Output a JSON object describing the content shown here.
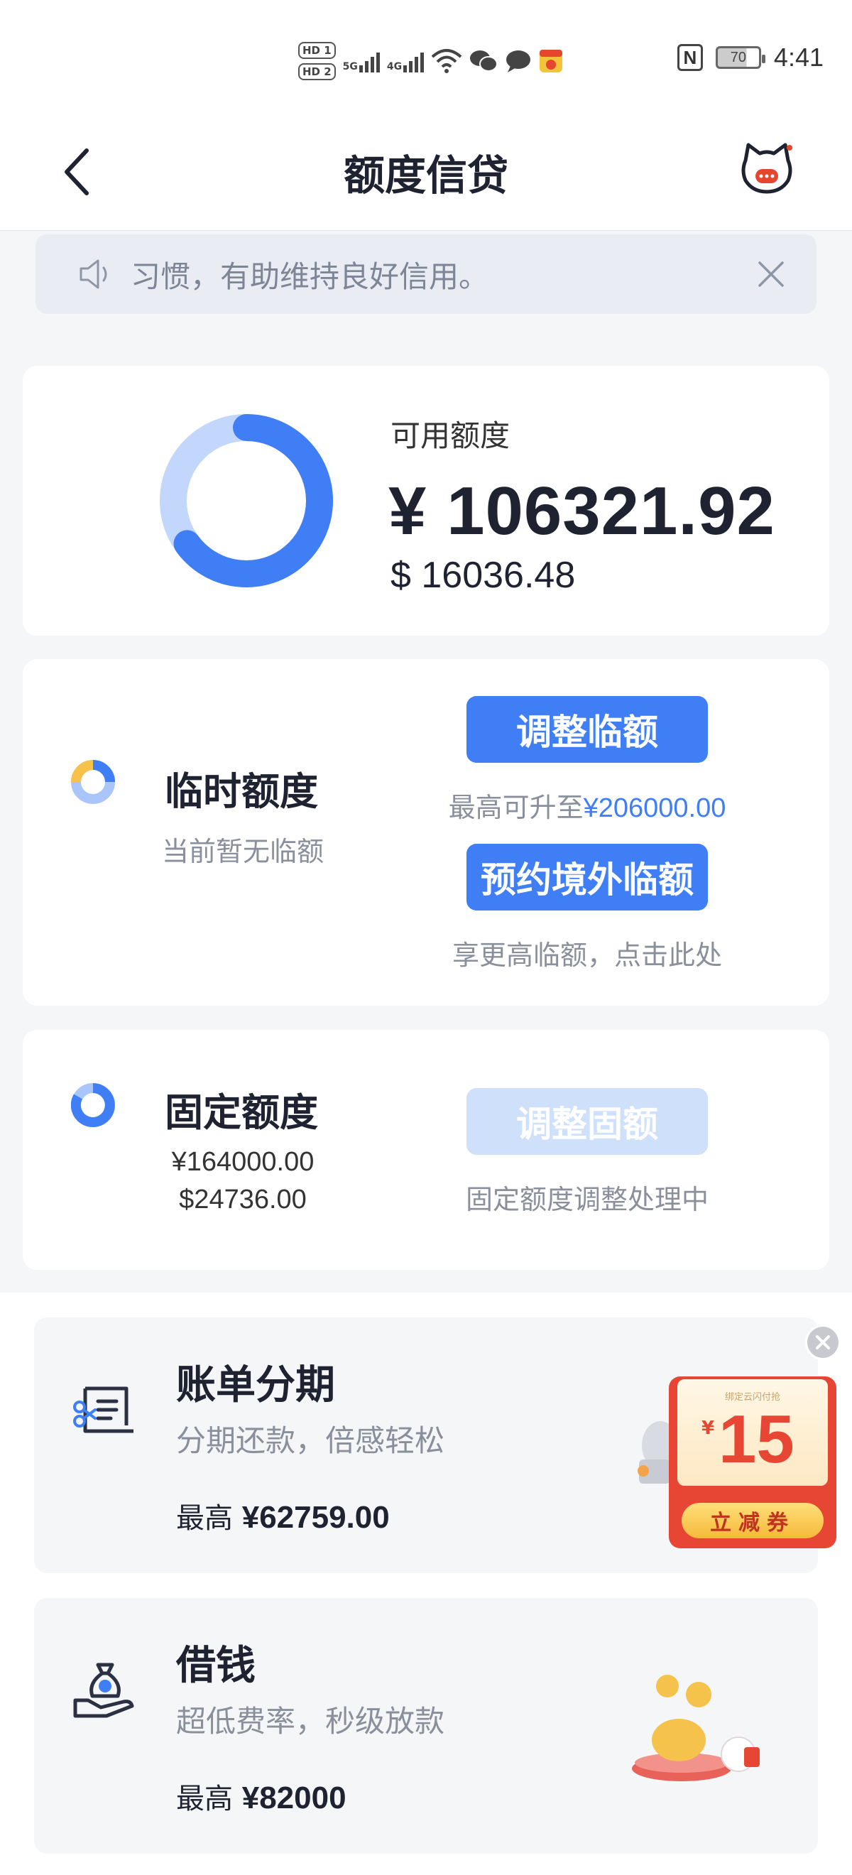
{
  "status_bar": {
    "hd1": "HD 1",
    "hd2": "HD 2",
    "net1": "5G",
    "net2": "4G",
    "battery": "70",
    "time": "4:41"
  },
  "header": {
    "title": "额度信贷"
  },
  "notice": {
    "text": "习惯，有助维持良好信用。"
  },
  "available": {
    "label": "可用额度",
    "cny": "¥ 106321.92",
    "usd": "$ 16036.48",
    "ring_fraction": 0.65,
    "colors": {
      "main": "#3f7ef5",
      "track": "#c3d6fb"
    }
  },
  "temporary": {
    "title": "临时额度",
    "sub": "当前暂无临额",
    "adjust_button": "调整临额",
    "max_prefix": "最高可升至",
    "max_value": "¥206000.00",
    "overseas_button": "预约境外临额",
    "overseas_note": "享更高临额，点击此处"
  },
  "fixed": {
    "title": "固定额度",
    "cny": "¥164000.00",
    "usd": "$24736.00",
    "adjust_button": "调整固额",
    "status": "固定额度调整处理中"
  },
  "services": [
    {
      "title": "账单分期",
      "sub": "分期还款，倍感轻松",
      "max_prefix": "最高",
      "max_value": "¥62759.00"
    },
    {
      "title": "借钱",
      "sub": "超低费率，秒级放款",
      "max_prefix": "最高",
      "max_value": "¥82000"
    }
  ],
  "coupon": {
    "top_text": "绑定云闪付抢",
    "currency": "¥",
    "amount": "15",
    "label": "立减券"
  }
}
